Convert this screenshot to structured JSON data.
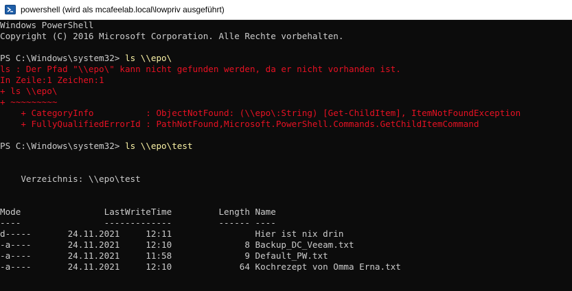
{
  "window": {
    "title": "powershell (wird als mcafeelab.local\\lowpriv ausgeführt)",
    "icon": "powershell-icon"
  },
  "colors": {
    "background": "#0c0c0c",
    "text": "#cccccc",
    "error": "#e81123",
    "command": "#f9f1a5"
  },
  "console": {
    "line1": "Windows PowerShell",
    "line2": "Copyright (C) 2016 Microsoft Corporation. Alle Rechte vorbehalten.",
    "prompt1": "PS C:\\Windows\\system32> ",
    "cmd1": "ls \\\\epo\\",
    "err1": "ls : Der Pfad \"\\\\epo\\\" kann nicht gefunden werden, da er nicht vorhanden ist.",
    "err2": "In Zeile:1 Zeichen:1",
    "err3": "+ ls \\\\epo\\",
    "err4": "+ ~~~~~~~~~",
    "err5": "    + CategoryInfo          : ObjectNotFound: (\\\\epo\\:String) [Get-ChildItem], ItemNotFoundException",
    "err6": "    + FullyQualifiedErrorId : PathNotFound,Microsoft.PowerShell.Commands.GetChildItemCommand",
    "prompt2": "PS C:\\Windows\\system32> ",
    "cmd2": "ls \\\\epo\\test",
    "dir_line": "    Verzeichnis: \\\\epo\\test",
    "header": "Mode                LastWriteTime         Length Name",
    "separator": "----                -------------         ------ ----",
    "rows": [
      "d-----       24.11.2021     12:11                Hier ist nix drin",
      "-a----       24.11.2021     12:10              8 Backup_DC_Veeam.txt",
      "-a----       24.11.2021     11:58              9 Default_PW.txt",
      "-a----       24.11.2021     12:10             64 Kochrezept von Omma Erna.txt"
    ]
  }
}
